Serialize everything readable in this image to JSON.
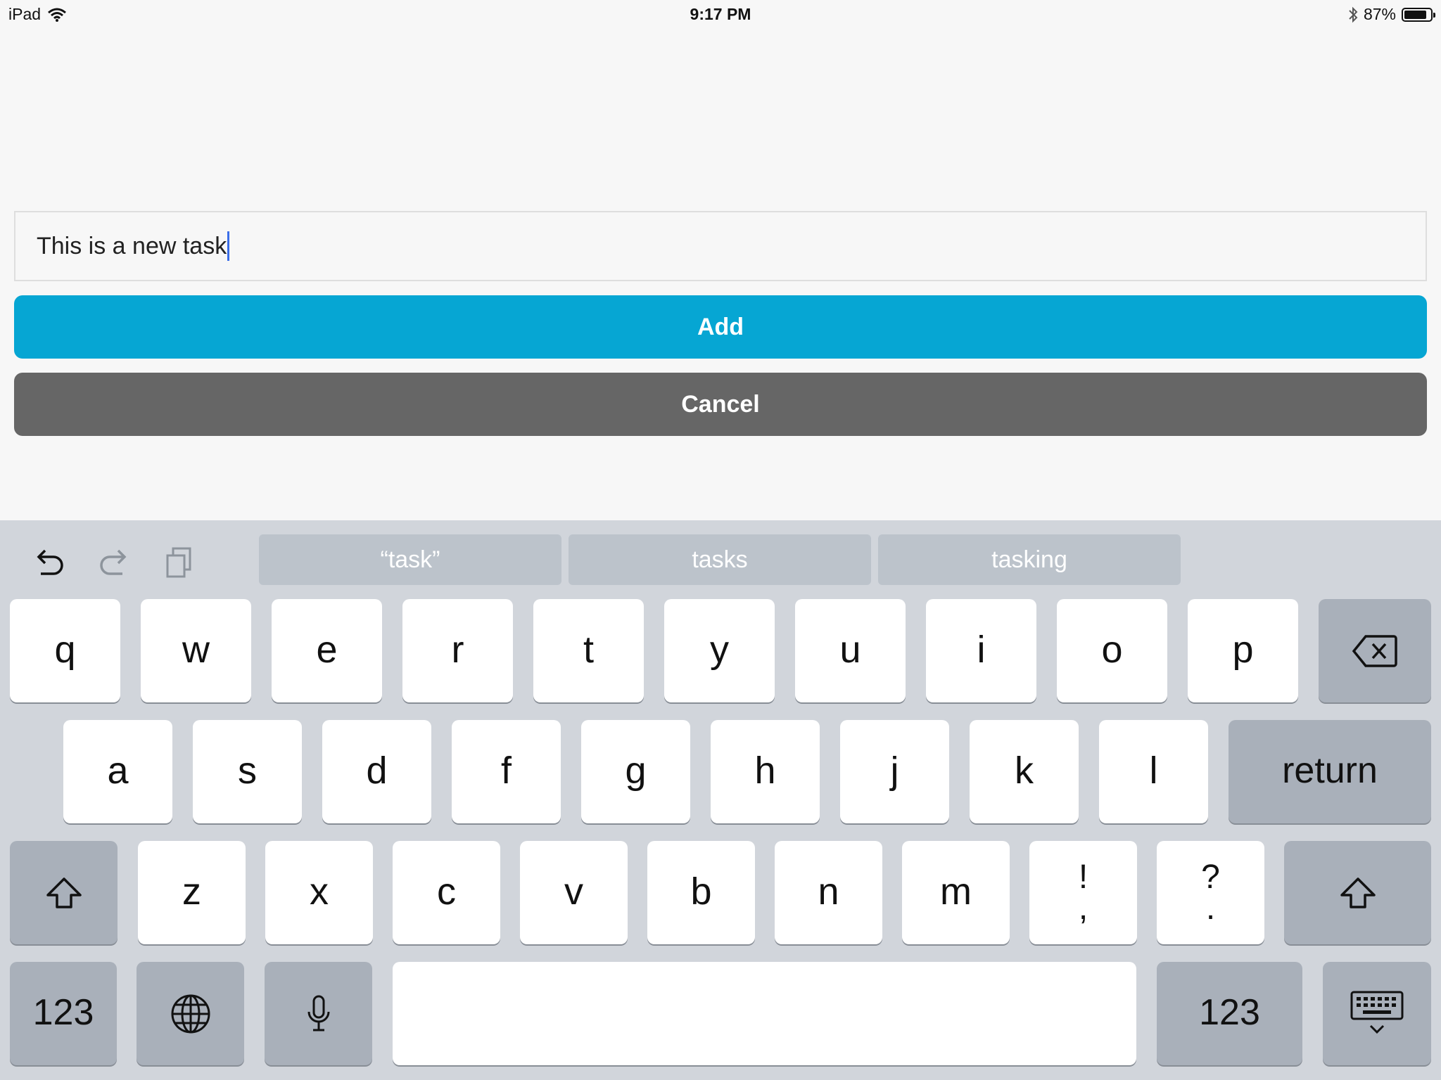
{
  "status_bar": {
    "device": "iPad",
    "time": "9:17 PM",
    "battery_percent": "87%",
    "battery_level": 0.87
  },
  "form": {
    "task_value": "This is a new task",
    "add_label": "Add",
    "cancel_label": "Cancel"
  },
  "colors": {
    "add_button": "#06a6d3",
    "cancel_button": "#666666",
    "keyboard_bg": "#d1d5db"
  },
  "keyboard": {
    "suggestions": [
      "“task”",
      "tasks",
      "tasking"
    ],
    "row1": [
      "q",
      "w",
      "e",
      "r",
      "t",
      "y",
      "u",
      "i",
      "o",
      "p"
    ],
    "row2": [
      "a",
      "s",
      "d",
      "f",
      "g",
      "h",
      "j",
      "k",
      "l"
    ],
    "row3": [
      "z",
      "x",
      "c",
      "v",
      "b",
      "n",
      "m"
    ],
    "punct1": {
      "top": "!",
      "bottom": ","
    },
    "punct2": {
      "top": "?",
      "bottom": "."
    },
    "return_label": "return",
    "numbers_label": "123",
    "icons": {
      "undo": "undo-icon",
      "redo": "redo-icon",
      "paste": "paste-icon",
      "delete": "delete-icon",
      "shift": "shift-icon",
      "globe": "globe-icon",
      "mic": "microphone-icon",
      "dismiss": "keyboard-dismiss-icon"
    }
  }
}
